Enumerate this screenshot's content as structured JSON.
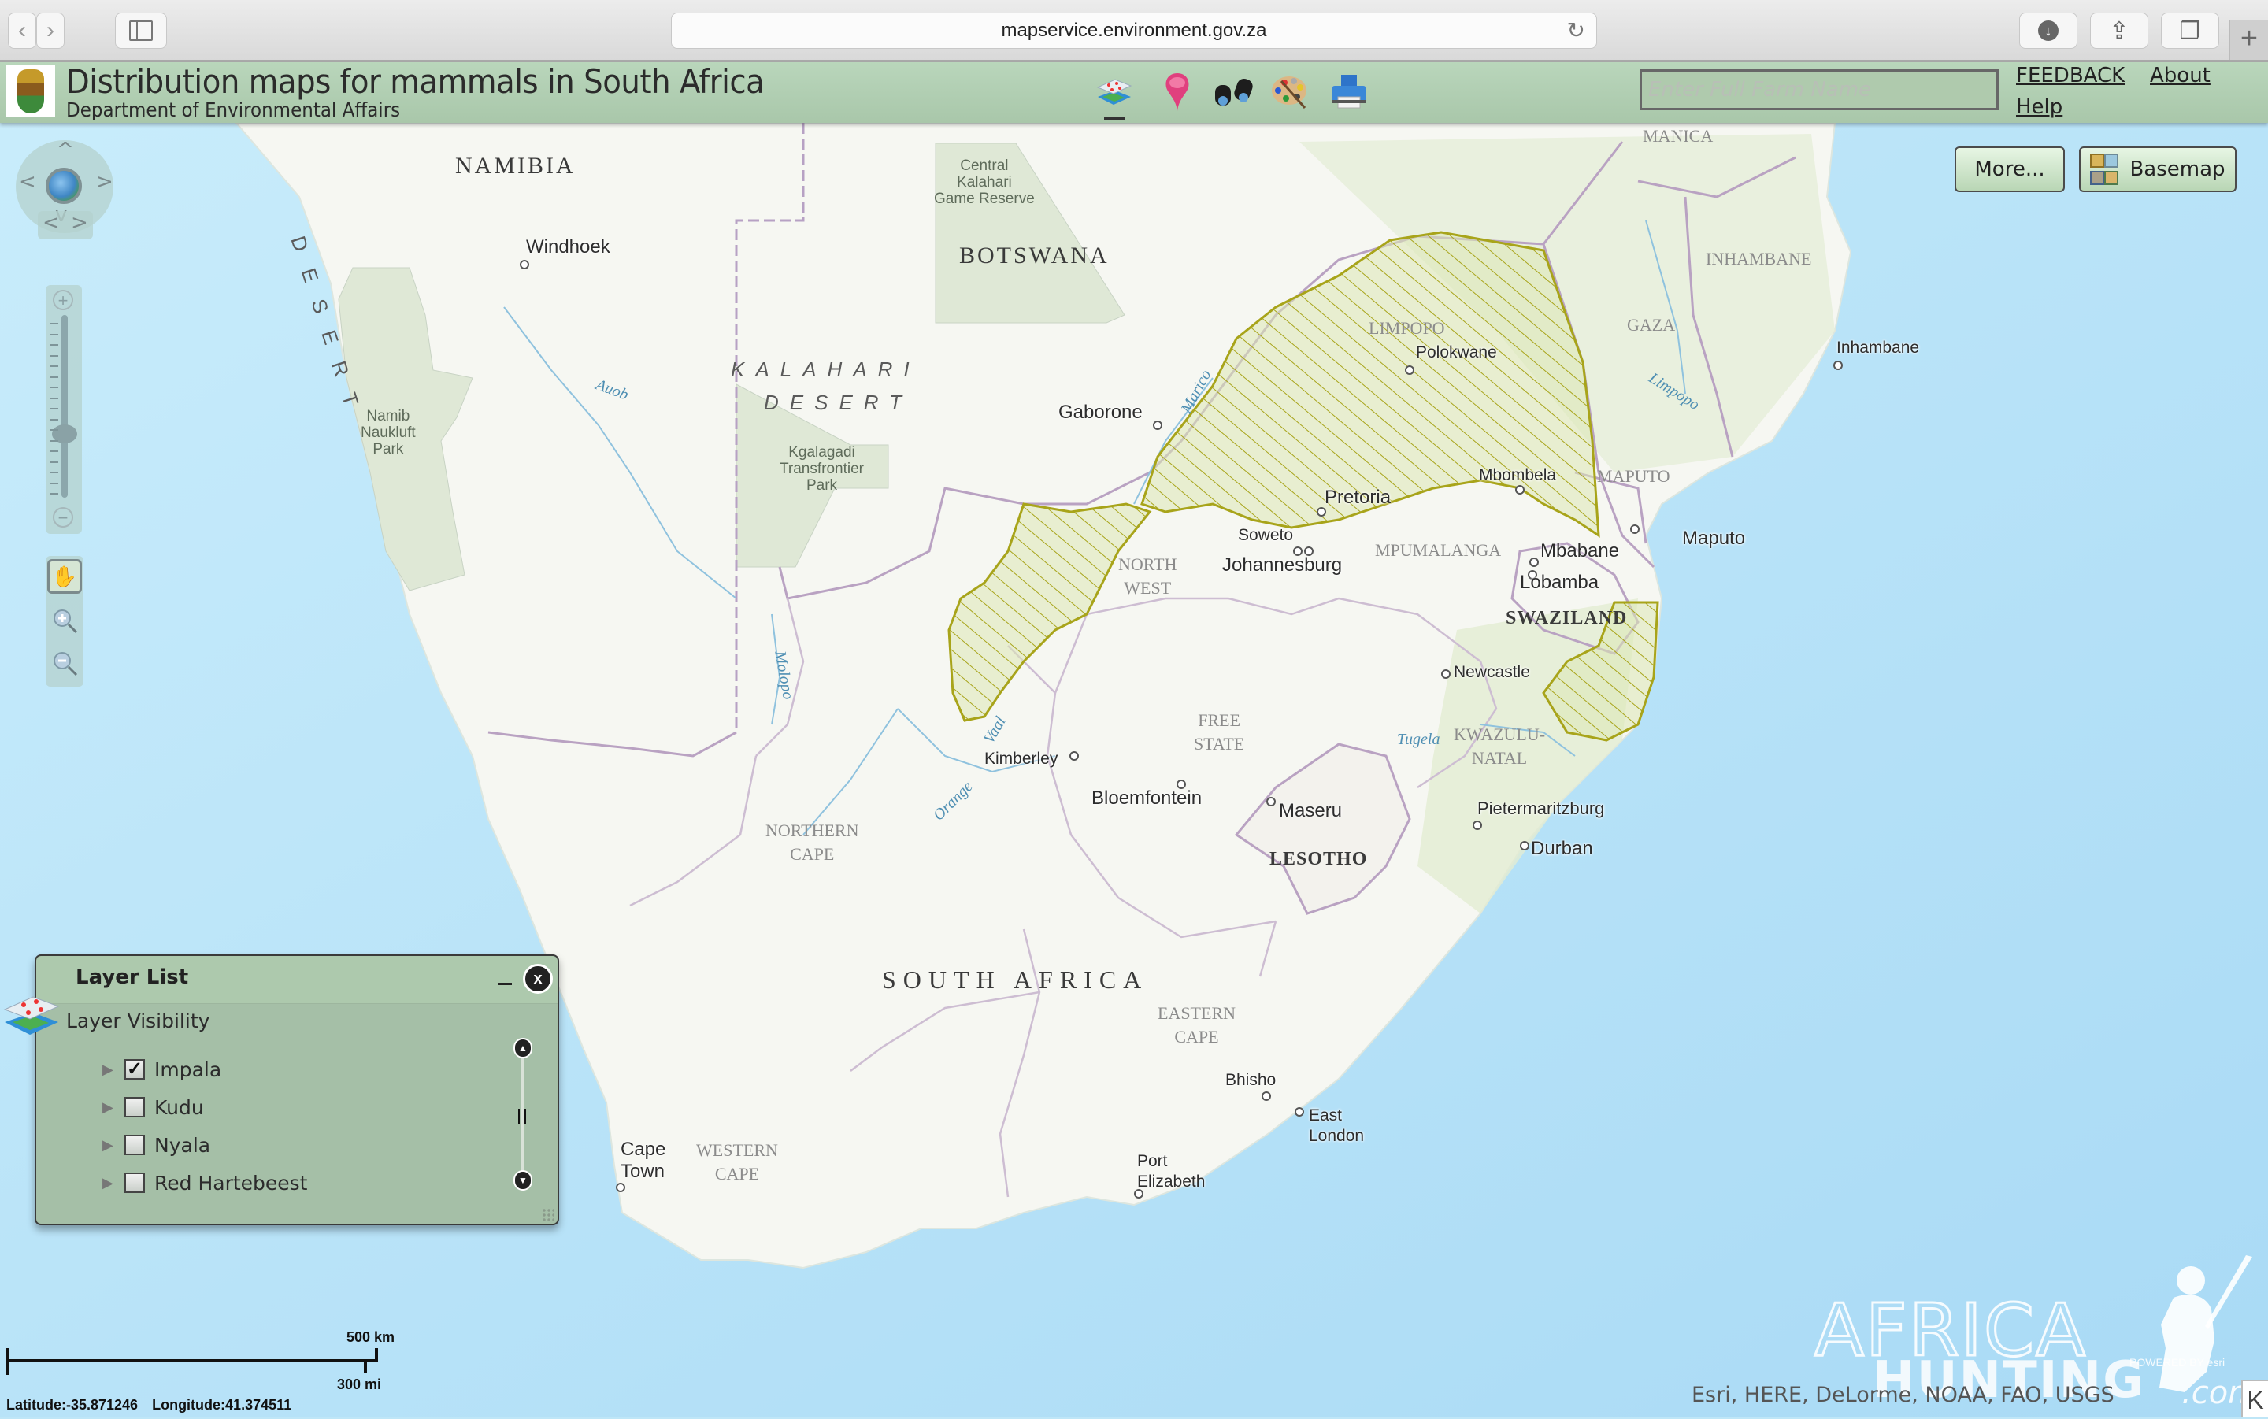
{
  "browser": {
    "url": "mapservice.environment.gov.za",
    "back_icon": "chevron-left",
    "forward_icon": "chevron-right",
    "sidebar_icon": "sidebar",
    "reload_icon": "reload",
    "download_icon": "download",
    "share_icon": "share",
    "tabs_icon": "tabs",
    "new_tab_label": "+"
  },
  "header": {
    "title": "Distribution maps for mammals in South Africa",
    "subtitle": "Department of Environmental Affairs",
    "toolbar": [
      {
        "name": "layers-tool",
        "icon": "layers-icon",
        "active": true
      },
      {
        "name": "place-marker-tool",
        "icon": "map-pin-icon",
        "active": false
      },
      {
        "name": "find-tool",
        "icon": "binoculars-icon",
        "active": false
      },
      {
        "name": "draw-tool",
        "icon": "palette-icon",
        "active": false
      },
      {
        "name": "print-tool",
        "icon": "printer-icon",
        "active": false
      }
    ],
    "search": {
      "placeholder": "Enter Full Farm Name",
      "value": ""
    },
    "links": {
      "feedback": "FEEDBACK",
      "about": "About",
      "help": "Help"
    }
  },
  "map_controls": {
    "more_label": "More...",
    "basemap_label": "Basemap",
    "pan_arrows": {
      "up": "^",
      "down": "v",
      "left": "<",
      "right": ">"
    },
    "history": {
      "prev": "<",
      "next": ">"
    },
    "zoom_in": "+",
    "zoom_out": "−",
    "zoom_level_fraction": 0.35,
    "tools": [
      "pan-hand",
      "zoom-in-box",
      "zoom-out-box"
    ]
  },
  "layer_list": {
    "title": "Layer List",
    "minimize": "_",
    "close": "x",
    "section": "Layer Visibility",
    "layers": [
      {
        "label": "Impala",
        "checked": true
      },
      {
        "label": "Kudu",
        "checked": false
      },
      {
        "label": "Nyala",
        "checked": false
      },
      {
        "label": "Red Hartebeest",
        "checked": false
      }
    ]
  },
  "map": {
    "countries": [
      "NAMIBIA",
      "BOTSWANA",
      "SOUTH AFRICA",
      "LESOTHO",
      "SWAZILAND"
    ],
    "provinces": {
      "limpopo": "LIMPOPO",
      "north_west": [
        "NORTH",
        "WEST"
      ],
      "mpumalanga": "MPUMALANGA",
      "free_state": [
        "FREE",
        "STATE"
      ],
      "kwazulu_natal": [
        "KWAZULU-",
        "NATAL"
      ],
      "northern_cape": [
        "NORTHERN",
        "CAPE"
      ],
      "eastern_cape": [
        "EASTERN",
        "CAPE"
      ],
      "western_cape": [
        "WESTERN",
        "CAPE"
      ],
      "manica": "MANICA",
      "inhambane": "INHAMBANE",
      "gaza": "GAZA",
      "maputo": "MAPUTO"
    },
    "parks": {
      "central_kalahari": [
        "Central",
        "Kalahari",
        "Game Reserve"
      ],
      "kgalagadi": [
        "Kgalagadi",
        "Transfrontier",
        "Park"
      ],
      "namib_naukluft": [
        "Namib",
        "Naukluft",
        "Park"
      ]
    },
    "deserts": {
      "kalahari": [
        "KALAHARI",
        "DESERT"
      ],
      "namib": "DESERT"
    },
    "rivers": [
      "Auob",
      "Marico",
      "Molopo",
      "Vaal",
      "Orange",
      "Tugela",
      "Limpopo"
    ],
    "cities": [
      "Windhoek",
      "Gaborone",
      "Polokwane",
      "Pretoria",
      "Soweto",
      "Johannesburg",
      "Mbombela",
      "Mbabane",
      "Lobamba",
      "Maputo",
      "Inhambane",
      "Newcastle",
      "Kimberley",
      "Bloemfontein",
      "Maseru",
      "Pietermaritzburg",
      "Durban",
      "Bhisho",
      "East London",
      "Port Elizabeth",
      "Cape Town"
    ],
    "highlight_layer": "Impala",
    "highlight_color": "#a8a41a"
  },
  "scalebar": {
    "km": "500 km",
    "mi": "300 mi"
  },
  "coordinates": {
    "latitude": "Latitude:-35.871246",
    "longitude": "Longitude:41.374511"
  },
  "attribution": "Esri, HERE, DeLorme, NOAA, FAO, USGS",
  "watermark": {
    "line1": "AFRICA",
    "line2": "HUNTING",
    "suffix": ".com",
    "powered": "POWERED BY esri"
  },
  "colors": {
    "header_bg": "#aec9ad",
    "ocean": "#bfe6f7",
    "land": "#f6f7f2",
    "park": "#dfe8d6",
    "border": "#b9a2c2",
    "impala": "#a8a41a"
  }
}
